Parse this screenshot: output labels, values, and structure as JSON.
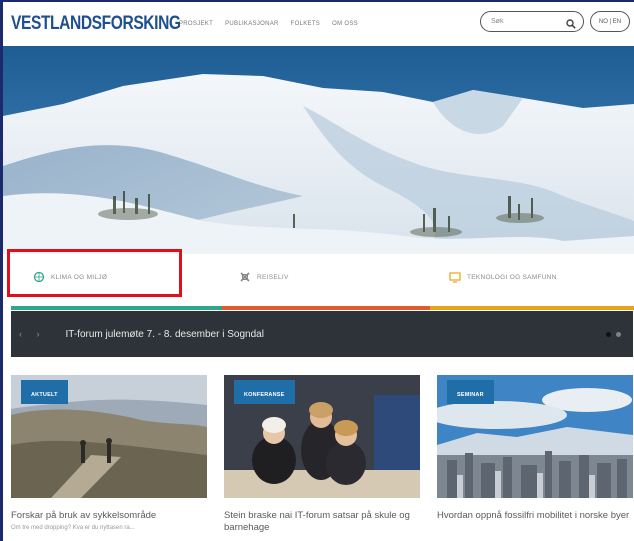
{
  "site": {
    "logo": "VESTLANDSFORSKING"
  },
  "nav": {
    "items": [
      {
        "label": "PROSJEKT"
      },
      {
        "label": "PUBLIKASJONAR"
      },
      {
        "label": "FOLKETS"
      },
      {
        "label": "OM OSS"
      }
    ]
  },
  "search": {
    "placeholder": "Søk"
  },
  "language": {
    "label": "NO | EN"
  },
  "categories": [
    {
      "label": "KLIMA OG MILJØ",
      "color": "#2fa48f"
    },
    {
      "label": "REISELIV",
      "color": "#e05a2a"
    },
    {
      "label": "TEKNOLOGI OG SAMFUNN",
      "color": "#e8a317"
    }
  ],
  "newsbar": {
    "arrows": "‹ ›",
    "headline": "IT-forum julemøte 7. - 8. desember i Sogndal"
  },
  "cards": [
    {
      "badge": "AKTUELT",
      "title": "Forskar på bruk av sykkelsområde",
      "snippet": "Om tre med dropping? Kva er du nyttasen ra..."
    },
    {
      "badge": "KONFERANSE",
      "title": "Stein braske nai IT-forum satsar på skule og barnehage",
      "snippet": ""
    },
    {
      "badge": "SEMINAR",
      "title": "Hvordan oppnå fossilfri mobilitet i norske byer",
      "snippet": ""
    }
  ]
}
